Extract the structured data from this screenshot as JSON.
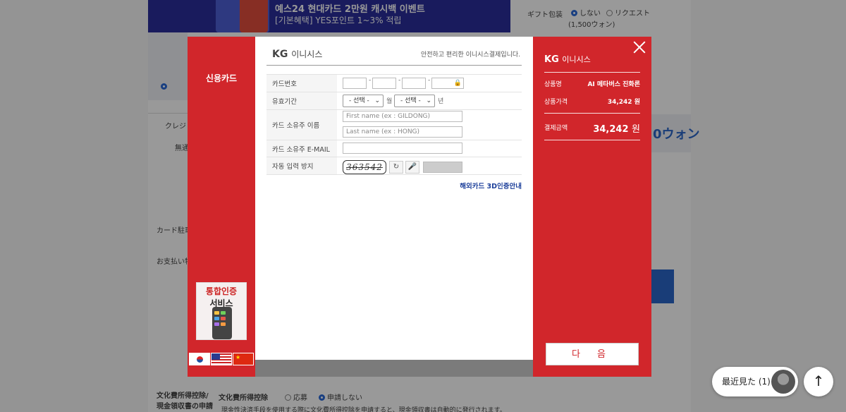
{
  "background": {
    "banner_line1": "예스24 현대카드 2만원 캐시백 이벤트",
    "banner_line2": "[기본혜택] YES포인트 1~3% 적립",
    "gift_label": "ギフト包装",
    "gift_opt1": "しない",
    "gift_opt2": "リクエスト",
    "gift_price": "(1,500ウォン)",
    "price_tail": "0ウォン",
    "tax_label": "文化費所得控除/現金領収書の申請",
    "tax_sub": "文化費所得控除",
    "tax_opt1": "応募",
    "tax_opt2": "申請しない",
    "tax_note": "現金性決済手段を使用する際に文化費所得控除を申請すると、現金領収書は自動的に発行されます。",
    "left_label1": "クレジ",
    "left_label2": "無通",
    "left_label3": "カード駐車",
    "left_label4": "お支払い特"
  },
  "modal": {
    "left_title": "신용카드",
    "cert_line1": "통합인증",
    "cert_line2": "서비스",
    "flags": [
      "korea-flag",
      "usa-flag",
      "china-flag"
    ],
    "brand": "KG",
    "brand_sub": "이니시스",
    "tagline": "안전하고 편리한 이니시스결제입니다.",
    "fields": {
      "card_number_label": "카드번호",
      "expiry_label": "유효기간",
      "month_select": "- 선택 -",
      "month_unit": "월",
      "year_select": "- 선택 -",
      "year_unit": "년",
      "name_label": "카드 소유주 이름",
      "first_name_placeholder": "First name (ex : GILDONG)",
      "last_name_placeholder": "Last name (ex : HONG)",
      "email_label": "카드 소유주 E-MAIL",
      "captcha_label": "자동 입력 방지",
      "captcha_text": "363542"
    },
    "overseas_link": "해외카드 3D인증안내",
    "summary": {
      "product_label": "상품명",
      "product_value": "AI 메타버스 진화론",
      "price_label": "상품가격",
      "price_value": "34,242 원",
      "total_label": "결제금액",
      "total_amount": "34,242",
      "total_unit": "원"
    },
    "next_button": "다 음"
  },
  "widgets": {
    "recent_label": "最近見た (1)",
    "top_icon": "arrow-up-icon"
  },
  "colors": {
    "brand_red": "#d1262b",
    "link_blue": "#1c3f9a"
  }
}
